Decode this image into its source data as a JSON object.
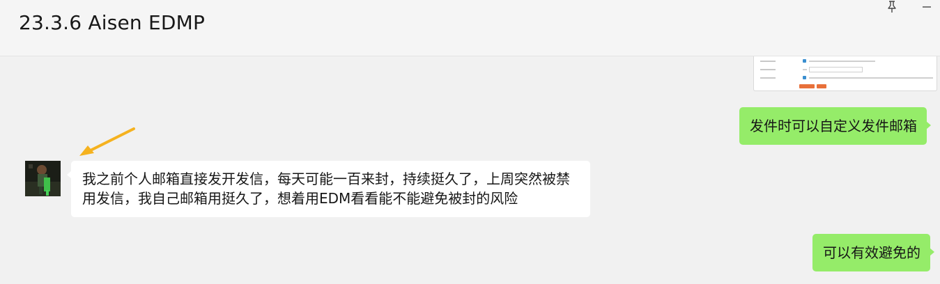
{
  "window": {
    "title": "23.3.6 Aisen EDMP",
    "pin_icon": "pin-icon",
    "minimize_icon": "minimize-icon"
  },
  "messages": [
    {
      "side": "right",
      "type": "image",
      "description_icon": "settings-screenshot-thumbnail"
    },
    {
      "side": "right",
      "type": "text",
      "text": "发件时可以自定义发件邮箱"
    },
    {
      "side": "left",
      "type": "text",
      "text": "我之前个人邮箱直接发开发信，每天可能一百来封，持续挺久了，上周突然被禁用发信，我自己邮箱用挺久了，想着用EDM看看能不能避免被封的风险"
    },
    {
      "side": "right",
      "type": "text",
      "text": "可以有效避免的"
    }
  ],
  "colors": {
    "outgoing_bubble": "#95ec69",
    "incoming_bubble": "#ffffff",
    "background": "#f1f1f1",
    "annotation_arrow": "#f5b21f"
  }
}
